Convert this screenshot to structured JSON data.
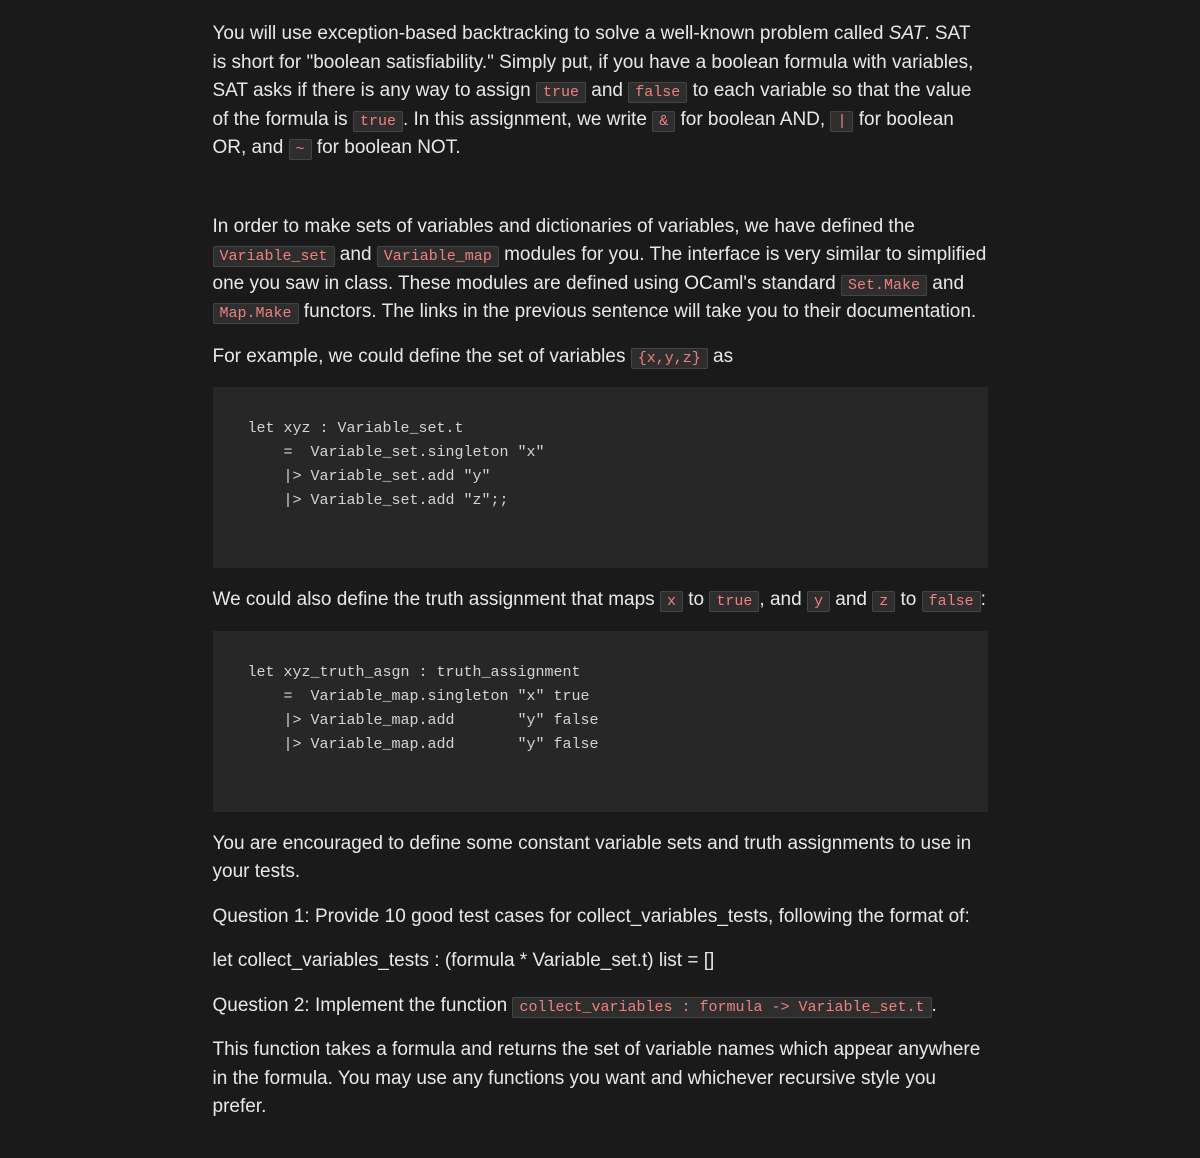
{
  "p1": {
    "t1": "You will use exception-based backtracking to solve a well-known problem called ",
    "em": "SAT",
    "t2": ". SAT is short for \"boolean satisfiability.\" Simply put, if you have a boolean formula with variables, SAT asks if there is any way to assign ",
    "c1": "true",
    "t3": " and ",
    "c2": "false",
    "t4": " to each variable so that the value of the formula is ",
    "c3": "true",
    "t5": ". In this assignment, we write ",
    "c4": "&",
    "t6": " for boolean AND, ",
    "c5": "|",
    "t7": " for boolean OR, and ",
    "c6": "~",
    "t8": " for boolean NOT."
  },
  "p2": {
    "t1": "In order to make sets of variables and dictionaries of variables, we have defined the ",
    "c1": "Variable_set",
    "t2": " and ",
    "c2": "Variable_map",
    "t3": " modules for you. The interface is very similar to simplified one you saw in class. These modules are defined using OCaml's standard ",
    "c3": "Set.Make",
    "t4": " and ",
    "c4": "Map.Make",
    "t5": " functors. The links in the previous sentence will take you to their documentation."
  },
  "p3": {
    "t1": "For example, we could define the set of variables ",
    "c1": "{x,y,z}",
    "t2": " as"
  },
  "code1": "let xyz : Variable_set.t\n    =  Variable_set.singleton \"x\"\n    |> Variable_set.add \"y\"\n    |> Variable_set.add \"z\";;",
  "p4": {
    "t1": "We could also define the truth assignment that maps ",
    "c1": "x",
    "t2": " to ",
    "c2": "true",
    "t3": ", and ",
    "c3": "y",
    "t4": " and ",
    "c4": "z",
    "t5": " to ",
    "c5": "false",
    "t6": ":"
  },
  "code2": "let xyz_truth_asgn : truth_assignment\n    =  Variable_map.singleton \"x\" true\n    |> Variable_map.add       \"y\" false\n    |> Variable_map.add       \"y\" false",
  "p5": "You are encouraged to define some constant variable sets and truth assignments to use in your tests.",
  "p6": "Question 1: Provide 10 good test cases for collect_variables_tests, following the format of:",
  "p7": "let collect_variables_tests : (formula * Variable_set.t) list = []",
  "p8": {
    "t1": "Question 2: Implement the function ",
    "c1": "collect_variables : formula -> Variable_set.t",
    "t2": "."
  },
  "p9": "This function takes a formula and returns the set of variable names which appear anywhere in the formula. You may use any functions you want and whichever recursive style you prefer."
}
